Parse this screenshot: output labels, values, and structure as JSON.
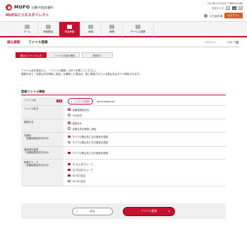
{
  "header": {
    "brand_top": "MUFG",
    "brand_bank": "三菱UFJ信託銀行",
    "brand_service": "MUFGビジネスダイレクト",
    "date": "2014年11月19日 13時00分00秒",
    "font_size_label": "文字サイズ",
    "font_sizes": [
      "小",
      "中",
      "大"
    ],
    "user_name": "〇〇太郎 様",
    "logout_label": "ログアウト"
  },
  "nav": {
    "items": [
      {
        "label": "ホーム",
        "icon": "home-icon"
      },
      {
        "label": "明細照会",
        "icon": "document-icon"
      },
      {
        "label": "資金移動",
        "icon": "transfer-icon"
      },
      {
        "label": "承認",
        "icon": "check-icon"
      },
      {
        "label": "管理",
        "icon": "gear-icon"
      },
      {
        "label": "サービス連携",
        "icon": "link-icon"
      }
    ],
    "active_index": 2
  },
  "title": {
    "category": "振込振替",
    "main": "ファイル登録",
    "tag": "BFKB001",
    "help": "ヘルプ"
  },
  "steps": [
    "振込元ファイル入力",
    "ファイル内容を確認",
    "登録完了"
  ],
  "intro": {
    "line1": "ファイル名を指定の上、「ファイル登録」ボタンを押してください。",
    "line2": "登録方法で「全振込先を削除し追加」を選択した場合は、既に登録されている振込先はすべて削除されます。"
  },
  "form": {
    "section_title": "登録ファイル情報",
    "rows": {
      "filename": {
        "label": "ファイル名",
        "required": "必須",
        "button": "ファイルを選択",
        "filename": "servicedata.txt"
      },
      "format": {
        "label": "ファイル形式",
        "options": [
          "全銀協規定形式",
          "CSV形式"
        ]
      },
      "method": {
        "label": "登録方法",
        "options": [
          "追加のみ",
          "全振込先を削除し追加"
        ]
      },
      "fee": {
        "label": "手数料\n（全銀協規定形式のみ）",
        "options": [
          "すべての振込先に当方負担を適用",
          "すべての振込先に先方負担を適用"
        ]
      },
      "zengin": {
        "label": "登録済先登録\n（全銀協規定形式のみ）",
        "options": [
          "すべての振込先に当方負担を適用"
        ]
      },
      "group": {
        "label": "所属グループ\n（全銀協規定形式のみ）",
        "options": [
          "01 仕入先グループ",
          "02 外注先グループ",
          "03 口口支払",
          "04 口口支払"
        ]
      }
    }
  },
  "actions": {
    "back": "戻る",
    "submit": "ファイル登録"
  }
}
